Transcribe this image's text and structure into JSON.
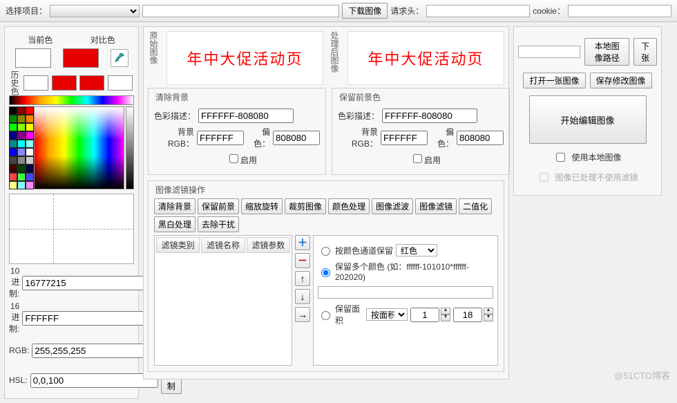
{
  "toolbar": {
    "project": "选择项目：",
    "download": "下载图像",
    "header": "请求头：",
    "cookie": "cookie："
  },
  "left": {
    "current": "当前色",
    "contrast": "对比色",
    "history": "历史色",
    "dec": "10进制:",
    "decv": "16777215",
    "hex": "16进制:",
    "hexv": "FFFFFF",
    "rgb": "RGB:",
    "rgbv": "255,255,255",
    "hsl": "HSL:",
    "hslv": "0,0,100",
    "copy": "复制"
  },
  "mid": {
    "orig": "原始图像",
    "proc": "处理后图像",
    "sample": "年中大促活动页",
    "clearbg": "清除背景",
    "keepfg": "保留前景色",
    "colordesc": "色彩描述：",
    "bgrgb": "背景RGB：",
    "offset": "偏色：",
    "enable": "启用",
    "descv": "FFFFFF-808080",
    "bgv": "FFFFFF",
    "offv": "808080",
    "filterop": "图像滤镜操作",
    "btns": [
      "清除背景",
      "保留前景",
      "缩放旋转",
      "裁剪图像",
      "颜色处理",
      "图像滤波",
      "图像滤镜",
      "二值化",
      "黑白处理",
      "去除干扰"
    ],
    "th": [
      "滤镜类别",
      "滤镜名称",
      "滤镜参数"
    ],
    "r1": "按颜色通道保留",
    "red": "红色",
    "r2": "保留多个颜色 (如：ffffff-101010*ffffff-202020)",
    "r3": "保留面积",
    "bymj": "按面积",
    "a1": "1",
    "a2": "18"
  },
  "right": {
    "path": "本地图像路径",
    "next": "下张",
    "open": "打开一张图像",
    "save": "保存修改图像",
    "edit": "开始编辑图像",
    "uselocal": "使用本地图像",
    "nofilter": "图像已处理不使用滤镜"
  },
  "wm": "@51CTO博客"
}
